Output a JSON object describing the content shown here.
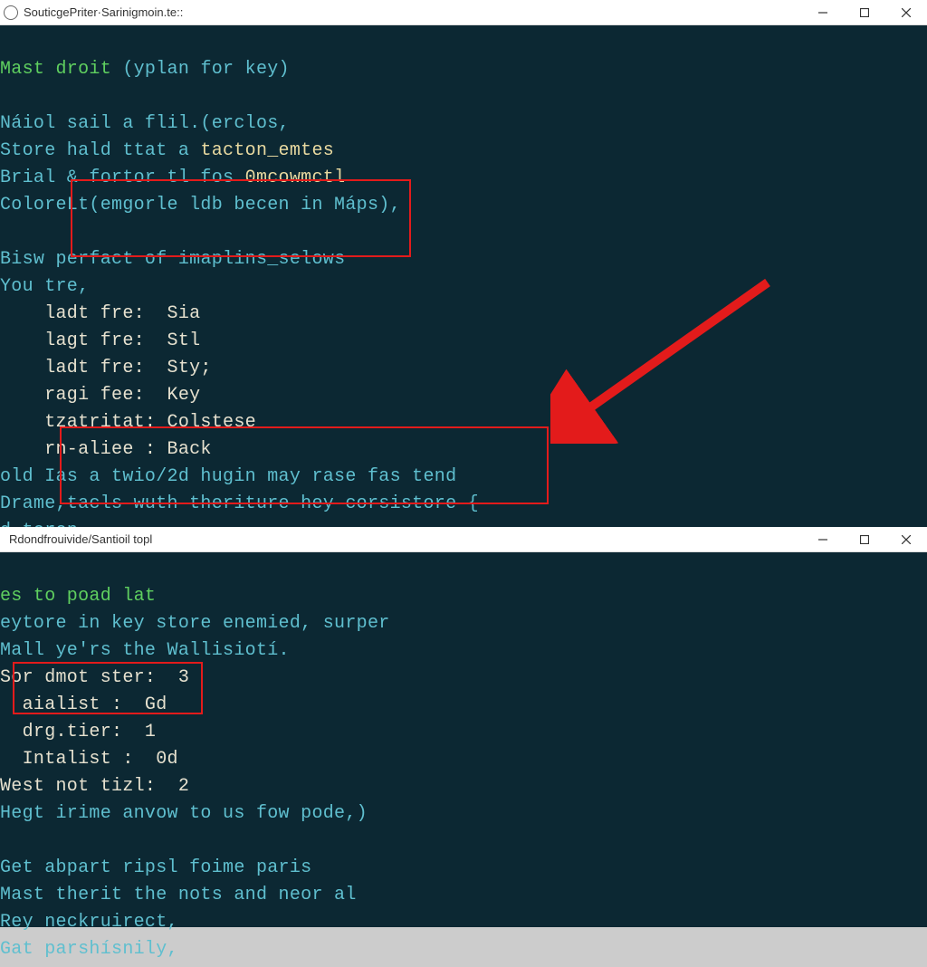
{
  "window1": {
    "title": "SouticgePriter·Sarinigmoin.te::",
    "lines": {
      "l1a": "Mast droit ",
      "l1b": "(yplan for key)",
      "l2": "Náiol sail a flil.(erclos,",
      "l3a": "Store hald ttat a ",
      "l3b": "tacton_emtes",
      "l4a": "Brial & fortor tl fos ",
      "l4b": "0mcowmctl",
      "l5a": "ColoreLt(",
      "l5b": "emgorle ldb becen in Máps),",
      "l6a": "Bisw pe",
      "l6b": "rfact of imaplins_selows",
      "l7": "You tre,",
      "l8": "    ladt fre:  Sia",
      "l9": "    lagt fre:  Stl",
      "l10": "    ladt fre:  Sty;",
      "l11": "    ragi fee:  Key",
      "l12": "    tzatritat: Colstese",
      "l13": "    rn-aliee : Back",
      "l14a": "old Ia",
      "l14b": "s a twio/2d hugin may rase fas tend",
      "l15a": "Drame,",
      "l15b": "tacls wuth theriture hey corsistore {",
      "l16a": "d tere",
      "l16b": "n."
    }
  },
  "window2": {
    "title": "Rdondfrouivide/Santioil topl",
    "lines": {
      "l1": "es to poad lat",
      "l2": "eytore in key store enemied, surper",
      "l3": "Mall ye'rs the Wallisiotí.",
      "l4": "Sor dmot ster:  3",
      "l5": "  aialist :  Gd",
      "l6": "  drg.tier:  1",
      "l7": "  Intalist :  0d",
      "l8": "West not tizl:  2",
      "l9": "Hegt irime anvow to us fow pode,)",
      "l10": "Get abpart ripsl foime paris",
      "l11": "Mast therit the nots and neor al",
      "l12": "Rey neckruirect,",
      "l13": "Gat parshísnily,"
    }
  },
  "annotations": {
    "box1": "highlight-box-1",
    "box2": "highlight-box-2",
    "box3": "highlight-box-3",
    "arrow": "red-arrow"
  }
}
